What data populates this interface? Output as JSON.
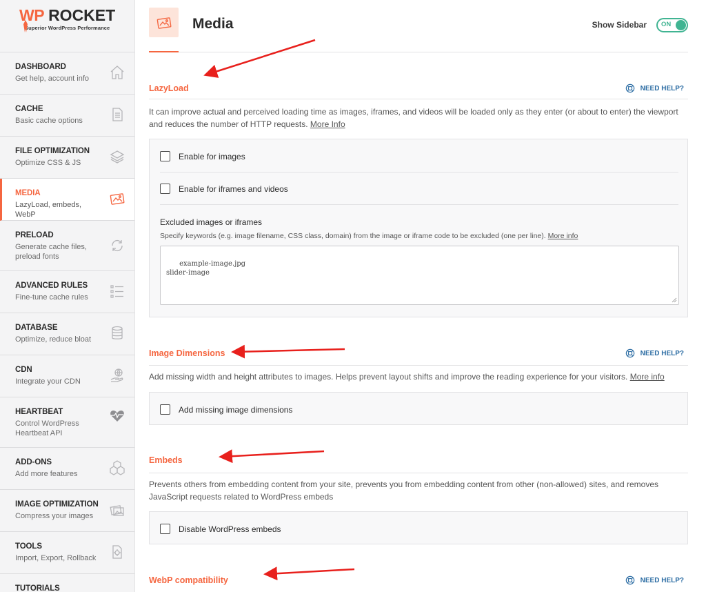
{
  "brand": {
    "name_part1": "WP",
    "name_part2": "ROCKET",
    "tagline": "Superior WordPress Performance"
  },
  "sidebar": {
    "items": [
      {
        "title": "DASHBOARD",
        "subtitle": "Get help, account info",
        "icon": "home-icon"
      },
      {
        "title": "CACHE",
        "subtitle": "Basic cache options",
        "icon": "document-icon"
      },
      {
        "title": "FILE OPTIMIZATION",
        "subtitle": "Optimize CSS & JS",
        "icon": "layers-icon"
      },
      {
        "title": "MEDIA",
        "subtitle": "LazyLoad, embeds, WebP",
        "icon": "media-icon"
      },
      {
        "title": "PRELOAD",
        "subtitle": "Generate cache files, preload fonts",
        "icon": "refresh-icon"
      },
      {
        "title": "ADVANCED RULES",
        "subtitle": "Fine-tune cache rules",
        "icon": "list-icon"
      },
      {
        "title": "DATABASE",
        "subtitle": "Optimize, reduce bloat",
        "icon": "database-icon"
      },
      {
        "title": "CDN",
        "subtitle": "Integrate your CDN",
        "icon": "cdn-hand-icon"
      },
      {
        "title": "HEARTBEAT",
        "subtitle": "Control WordPress Heartbeat API",
        "icon": "heart-pulse-icon"
      },
      {
        "title": "ADD-ONS",
        "subtitle": "Add more features",
        "icon": "cubes-icon"
      },
      {
        "title": "IMAGE OPTIMIZATION",
        "subtitle": "Compress your images",
        "icon": "images-icon"
      },
      {
        "title": "TOOLS",
        "subtitle": "Import, Export, Rollback",
        "icon": "tools-icon"
      },
      {
        "title": "TUTORIALS",
        "subtitle": "",
        "icon": ""
      }
    ]
  },
  "header": {
    "title": "Media",
    "show_sidebar_label": "Show Sidebar",
    "toggle_label": "ON"
  },
  "sections": {
    "lazyload": {
      "title": "LazyLoad",
      "help": "NEED HELP?",
      "description": "It can improve actual and perceived loading time as images, iframes, and videos will be loaded only as they enter (or about to enter) the viewport and reduces the number of HTTP requests.",
      "more_info": "More Info",
      "option_images": "Enable for images",
      "option_iframes": "Enable for iframes and videos",
      "excluded_title": "Excluded images or iframes",
      "excluded_help": "Specify keywords (e.g. image filename, CSS class, domain) from the image or iframe code to be excluded (one per line).",
      "excluded_more": "More info",
      "excluded_value": "example-image.jpg\nslider-image"
    },
    "dimensions": {
      "title": "Image Dimensions",
      "help": "NEED HELP?",
      "description": "Add missing width and height attributes to images. Helps prevent layout shifts and improve the reading experience for your visitors.",
      "more_info": "More info",
      "option": "Add missing image dimensions"
    },
    "embeds": {
      "title": "Embeds",
      "description": "Prevents others from embedding content from your site, prevents you from embedding content from other (non-allowed) sites, and removes JavaScript requests related to WordPress embeds",
      "option": "Disable WordPress embeds"
    },
    "webp": {
      "title": "WebP compatibility",
      "help": "NEED HELP?"
    }
  },
  "colors": {
    "accent": "#f56640",
    "toggle": "#40b492",
    "help": "#2b6ca3",
    "annotation_arrow": "#e8201c"
  }
}
